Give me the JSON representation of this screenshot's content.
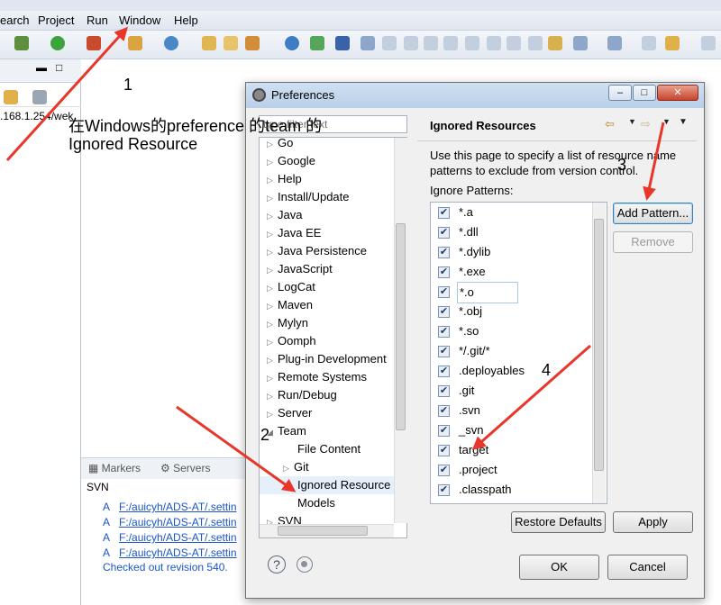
{
  "menubar": {
    "items": [
      "earch",
      "Project",
      "Run",
      "Window",
      "Help"
    ]
  },
  "left_panel": {
    "address_text": ".168.1.254/wek"
  },
  "console": {
    "tabs": [
      "Markers",
      "Servers"
    ],
    "header": "SVN",
    "lines": [
      {
        "prefix": "A",
        "path": "F:/auicyh/ADS-AT/.settin"
      },
      {
        "prefix": "A",
        "path": "F:/auicyh/ADS-AT/.settin"
      },
      {
        "prefix": "A",
        "path": "F:/auicyh/ADS-AT/.settin"
      },
      {
        "prefix": "A",
        "path": "F:/auicyh/ADS-AT/.settin"
      }
    ],
    "footer": "Checked out revision 540."
  },
  "dialog": {
    "title": "Preferences",
    "filter_placeholder": "type filter text",
    "tree": [
      {
        "label": "Go",
        "expandable": true
      },
      {
        "label": "Google",
        "expandable": true
      },
      {
        "label": "Help",
        "expandable": true
      },
      {
        "label": "Install/Update",
        "expandable": true
      },
      {
        "label": "Java",
        "expandable": true
      },
      {
        "label": "Java EE",
        "expandable": true
      },
      {
        "label": "Java Persistence",
        "expandable": true
      },
      {
        "label": "JavaScript",
        "expandable": true
      },
      {
        "label": "LogCat",
        "expandable": true
      },
      {
        "label": "Maven",
        "expandable": true
      },
      {
        "label": "Mylyn",
        "expandable": true
      },
      {
        "label": "Oomph",
        "expandable": true
      },
      {
        "label": "Plug-in Development",
        "expandable": true
      },
      {
        "label": "Remote Systems",
        "expandable": true
      },
      {
        "label": "Run/Debug",
        "expandable": true
      },
      {
        "label": "Server",
        "expandable": true
      },
      {
        "label": "Team",
        "expandable": true,
        "expanded": true
      },
      {
        "label": "File Content",
        "child": true
      },
      {
        "label": "Git",
        "child": true,
        "expandable": true
      },
      {
        "label": "Ignored Resource",
        "child": true,
        "selected": true
      },
      {
        "label": "Models",
        "child": true
      },
      {
        "label": "SVN",
        "expandable": true
      }
    ],
    "page_heading": "Ignored Resources",
    "description": "Use this page to specify a list of resource name patterns to exclude from version control.",
    "patterns_label": "Ignore Patterns:",
    "patterns": [
      "*.a",
      "*.dll",
      "*.dylib",
      "*.exe",
      "*.o",
      "*.obj",
      "*.so",
      "*/.git/*",
      ".deployables",
      ".git",
      ".svn",
      "_svn",
      "target",
      ".project",
      ".classpath"
    ],
    "selected_pattern": "*.o",
    "buttons": {
      "add_pattern": "Add Pattern...",
      "remove": "Remove",
      "restore_defaults": "Restore Defaults",
      "apply": "Apply",
      "ok": "OK",
      "cancel": "Cancel"
    }
  },
  "annotations": {
    "n1": "1",
    "n2": "2",
    "n3": "3",
    "n4": "4",
    "caption_line1": "在Windows的preference 的team 的",
    "caption_line2": "Ignored Resource"
  },
  "colors": {
    "arrow": "#e8362a",
    "link": "#1a55c9"
  }
}
